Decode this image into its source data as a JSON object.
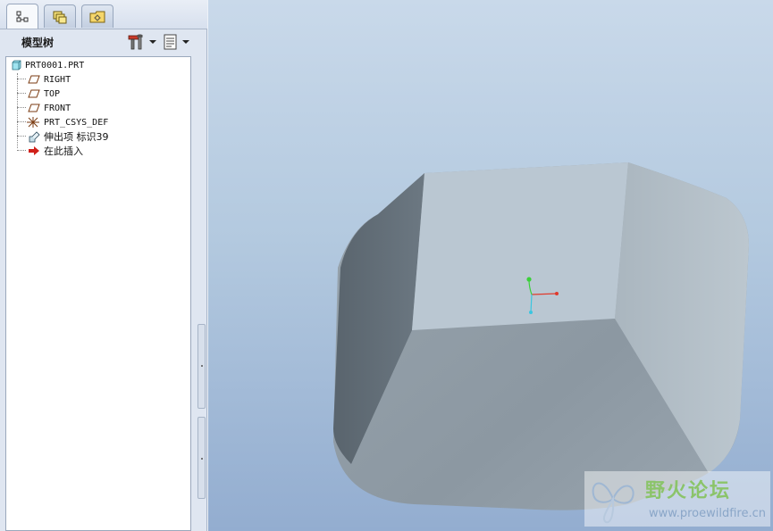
{
  "navigator": {
    "tabs": [
      {
        "name": "model-tree-tab-icon",
        "active": true
      },
      {
        "name": "layers-tab-icon",
        "active": false
      },
      {
        "name": "folder-browser-tab-icon",
        "active": false
      }
    ],
    "tree_title": "模型树",
    "settings_icon": "tools-icon",
    "show_icon": "list-icon"
  },
  "tree": {
    "root": {
      "label": "PRT0001.PRT",
      "icon": "part-icon"
    },
    "items": [
      {
        "label": "RIGHT",
        "icon": "datum-plane-icon"
      },
      {
        "label": "TOP",
        "icon": "datum-plane-icon"
      },
      {
        "label": "FRONT",
        "icon": "datum-plane-icon"
      },
      {
        "label": "PRT_CSYS_DEF",
        "icon": "coordinate-system-icon"
      },
      {
        "label": "伸出项 标识39",
        "icon": "extrude-feature-icon"
      },
      {
        "label": "在此插入",
        "icon": "insert-here-arrow-icon"
      }
    ]
  },
  "colors": {
    "viewport_top": "#c9d9ea",
    "viewport_bottom": "#93add0",
    "model_top_face": "#b9c6d2",
    "model_front_face": "#8e9ba6",
    "model_left_face": "#5f6a73",
    "csys_x": "#e03a2c",
    "csys_y": "#3ad13a",
    "csys_z": "#3ac6e0"
  },
  "watermark": {
    "title": "野火论坛",
    "url": "www.proewildfire.cn"
  }
}
